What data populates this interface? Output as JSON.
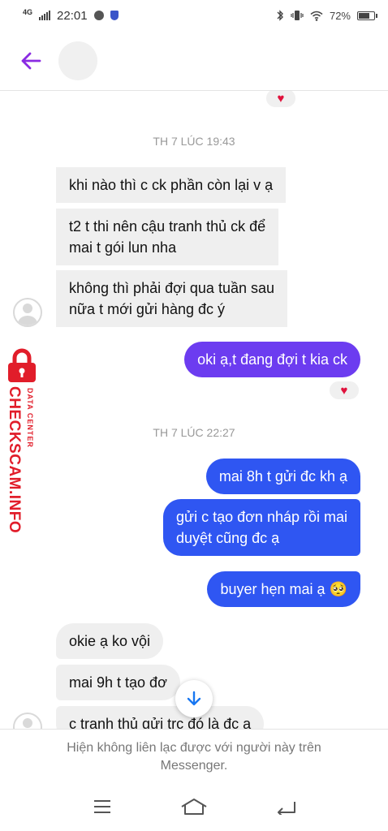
{
  "status_bar": {
    "network": "4G",
    "time": "22:01",
    "battery": "72%",
    "battery_level": 0.72
  },
  "header": {
    "back_icon": "arrow-left-icon",
    "accent_color": "#8a2be2"
  },
  "conversation": {
    "sections": [
      {
        "timestamp": "TH 7 LÚC 19:43",
        "messages": [
          {
            "side": "in",
            "text": "khi nào thì c ck phần còn lại v ạ"
          },
          {
            "side": "in",
            "text": "t2 t thi nên cậu tranh thủ ck để mai t gói lun nha",
            "lines": [
              "t2 t thi nên cậu tranh thủ ck để",
              "mai t gói lun nha"
            ]
          },
          {
            "side": "in",
            "text": "không thì phải đợi qua tuần sau nữa t mới gửi hàng đc ý",
            "lines": [
              "không thì phải đợi qua tuần sau",
              "nữa t mới gửi hàng đc ý"
            ]
          },
          {
            "side": "out",
            "text": "oki ạ,t đang đợi t kia ck",
            "reaction": "heart"
          }
        ]
      },
      {
        "timestamp": "TH 7 LÚC 22:27",
        "messages": [
          {
            "side": "out",
            "text": "mai 8h t gửi đc kh ạ"
          },
          {
            "side": "out",
            "text": "gửi c tạo đơn nháp rồi mai duyệt cũng đc ạ",
            "lines": [
              "gửi c tạo đơn nháp rồi mai",
              "duyệt cũng đc ạ"
            ]
          },
          {
            "side": "out",
            "text": "buyer hẹn mai ạ",
            "emoji": "🥺"
          },
          {
            "side": "in",
            "text": "okie ạ ko vội"
          },
          {
            "side": "in",
            "text": "mai 9h t tạo đơ"
          },
          {
            "side": "in",
            "text": "c tranh thủ gửi trc đó là đc ạ"
          }
        ]
      }
    ],
    "top_reaction": "heart"
  },
  "watermark": {
    "brand": "CHECKSCAM.INFO",
    "tagline": "DATA CENTER",
    "color": "#e11d2a"
  },
  "footer": {
    "notice_line1": "Hiện không liên lạc được với người này trên",
    "notice_line2": "Messenger."
  },
  "colors": {
    "bubble_in": "#efefef",
    "bubble_out_purple": "#6c3cf0",
    "bubble_out_blue": "#2f56f2",
    "heart": "#e0123c"
  },
  "nav": {
    "icons": [
      "menu-icon",
      "home-icon",
      "back-icon"
    ]
  }
}
